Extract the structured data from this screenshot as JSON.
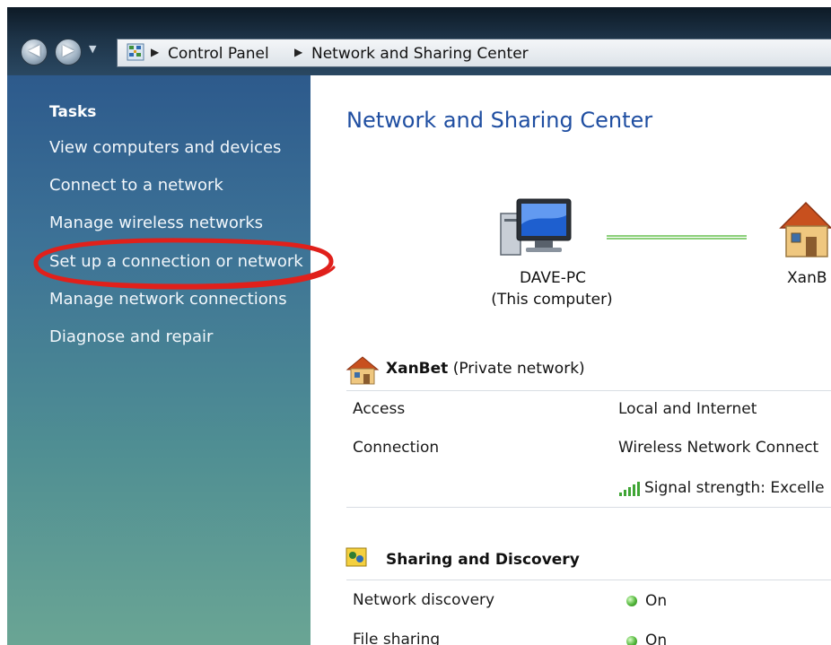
{
  "address_bar": {
    "crumbs": [
      "Control Panel",
      "Network and Sharing Center"
    ],
    "nav_dropdown_icon": "chevron-down-icon",
    "location_icon": "control-panel-icon"
  },
  "sidebar": {
    "title": "Tasks",
    "items": [
      {
        "label": "View computers and devices"
      },
      {
        "label": "Connect to a network"
      },
      {
        "label": "Manage wireless networks"
      },
      {
        "label": "Set up a connection or network",
        "highlighted": true
      },
      {
        "label": "Manage network connections"
      },
      {
        "label": "Diagnose and repair"
      }
    ],
    "highlight_color": "#e0201b"
  },
  "main": {
    "title": "Network and Sharing Center",
    "map": {
      "computer_name": "DAVE-PC",
      "computer_sub": "(This computer)",
      "network_name": "XanB"
    },
    "network": {
      "name": "XanBet",
      "type": "(Private network)",
      "rows": [
        {
          "label": "Access",
          "value": "Local and Internet"
        },
        {
          "label": "Connection",
          "value": "Wireless Network Connect"
        }
      ],
      "signal_text": "Signal strength:  Excelle"
    },
    "sharing": {
      "title": "Sharing and Discovery",
      "rows": [
        {
          "label": "Network discovery",
          "value": "On"
        },
        {
          "label": "File sharing",
          "value": "On"
        }
      ]
    }
  },
  "colors": {
    "title_blue": "#1f4ea1",
    "status_green": "#52b63a",
    "link_line_green": "#8cd07a"
  }
}
